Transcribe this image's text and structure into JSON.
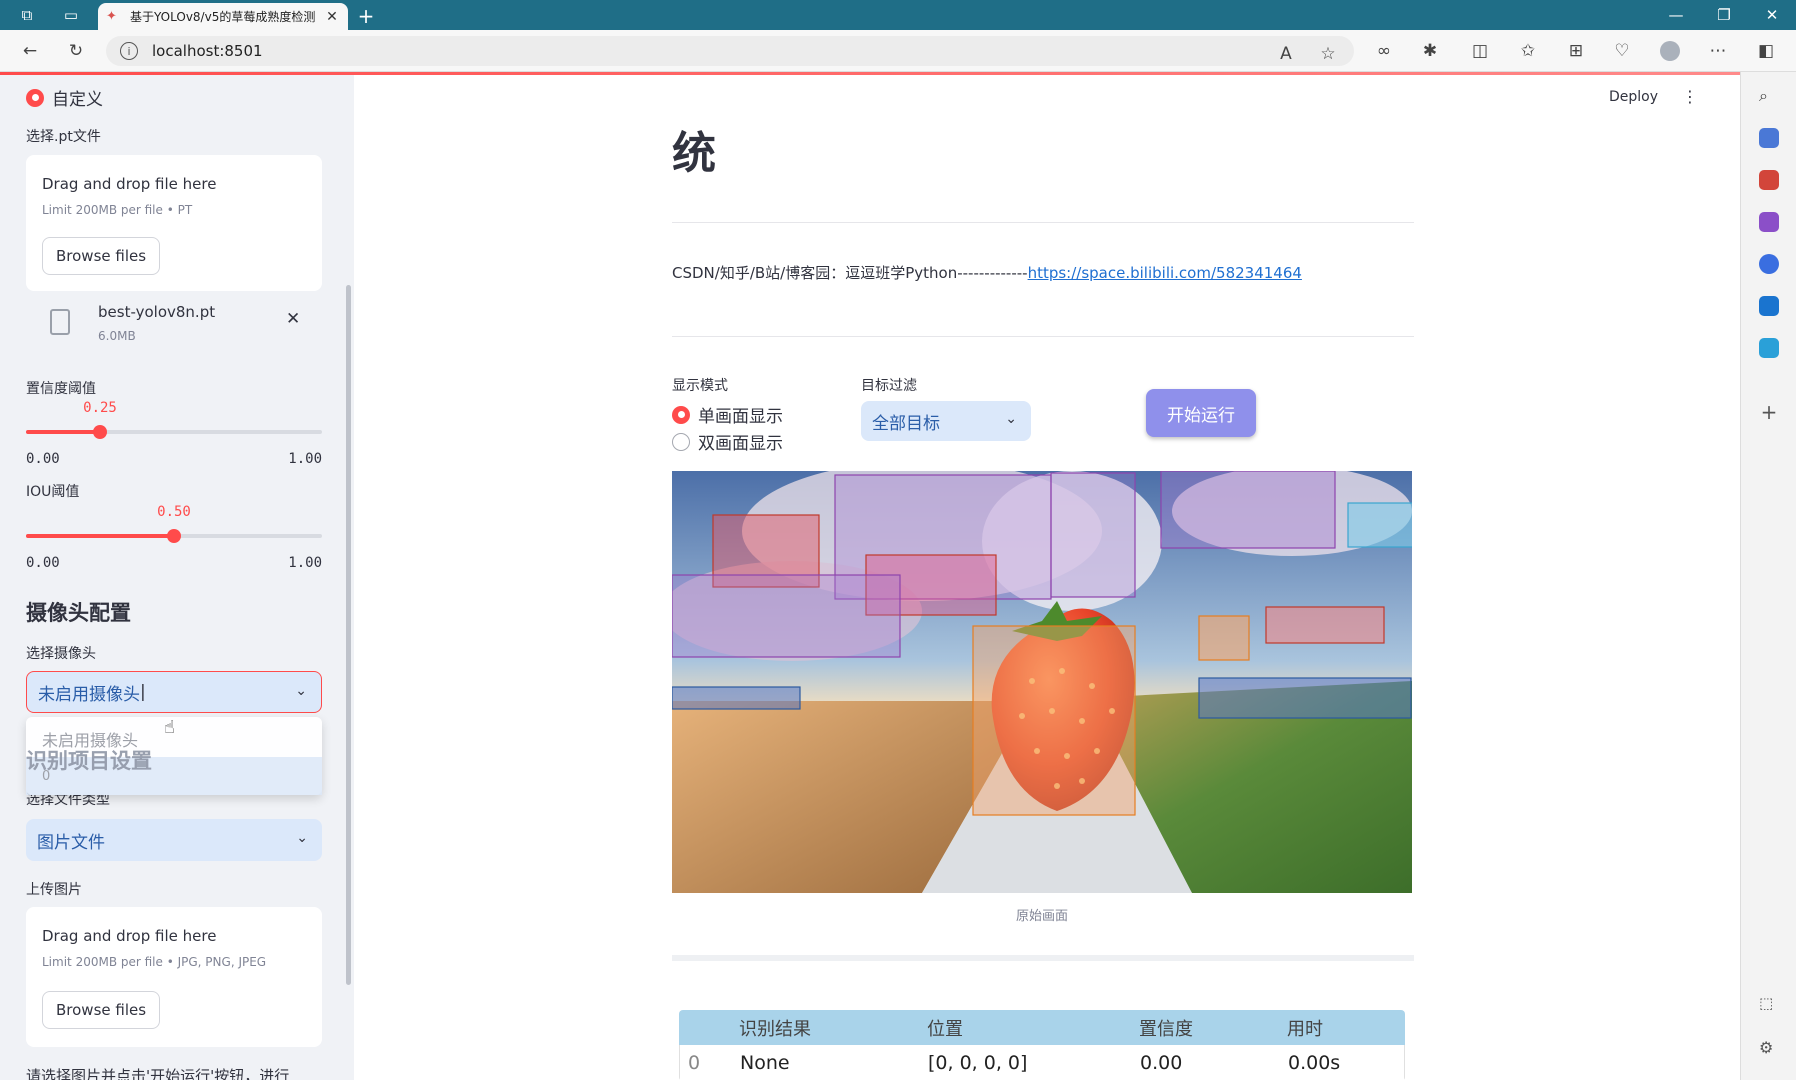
{
  "browser": {
    "tab_title": "基于YOLOv8/v5的草莓成熟度检测",
    "address": "localhost:8501"
  },
  "sidebar": {
    "model_radio_label": "自定义",
    "pt_label": "选择.pt文件",
    "pt_uploader": {
      "drag_text": "Drag and drop file here",
      "limit_text": "Limit 200MB per file • PT",
      "browse_label": "Browse files"
    },
    "uploaded_file": {
      "name": "best-yolov8n.pt",
      "size": "6.0MB"
    },
    "confidence": {
      "label": "置信度阈值",
      "value": 0.25,
      "value_text": "0.25",
      "min_text": "0.00",
      "max_text": "1.00"
    },
    "iou": {
      "label": "IOU阈值",
      "value": 0.5,
      "value_text": "0.50",
      "min_text": "0.00",
      "max_text": "1.00"
    },
    "camera_section": "摄像头配置",
    "camera_label": "选择摄像头",
    "camera_value": "未启用摄像头",
    "camera_options": [
      "未启用摄像头",
      "0"
    ],
    "project_section": "识别项目设置",
    "file_type_label": "选择文件类型",
    "file_type_value": "图片文件",
    "upload_image_label": "上传图片",
    "image_uploader": {
      "drag_text": "Drag and drop file here",
      "limit_text": "Limit 200MB per file • JPG, PNG, JPEG",
      "browse_label": "Browse files"
    },
    "bottom_hint": "请选择图片并点击'开始运行'按钮，进行"
  },
  "main": {
    "deploy_label": "Deploy",
    "title": "统",
    "credit_text": "CSDN/知乎/B站/博客园：逗逗班学Python-------------",
    "credit_link": "https://space.bilibili.com/582341464",
    "display_mode_label": "显示模式",
    "display_modes": [
      "单画面显示",
      "双画面显示"
    ],
    "target_filter_label": "目标过滤",
    "target_filter_value": "全部目标",
    "run_button": "开始运行",
    "image_caption": "原始画面",
    "table": {
      "headers": [
        "",
        "识别结果",
        "位置",
        "置信度",
        "用时"
      ],
      "rows": [
        [
          "0",
          "None",
          "[0, 0, 0, 0]",
          "0.00",
          "0.00s"
        ]
      ]
    }
  }
}
